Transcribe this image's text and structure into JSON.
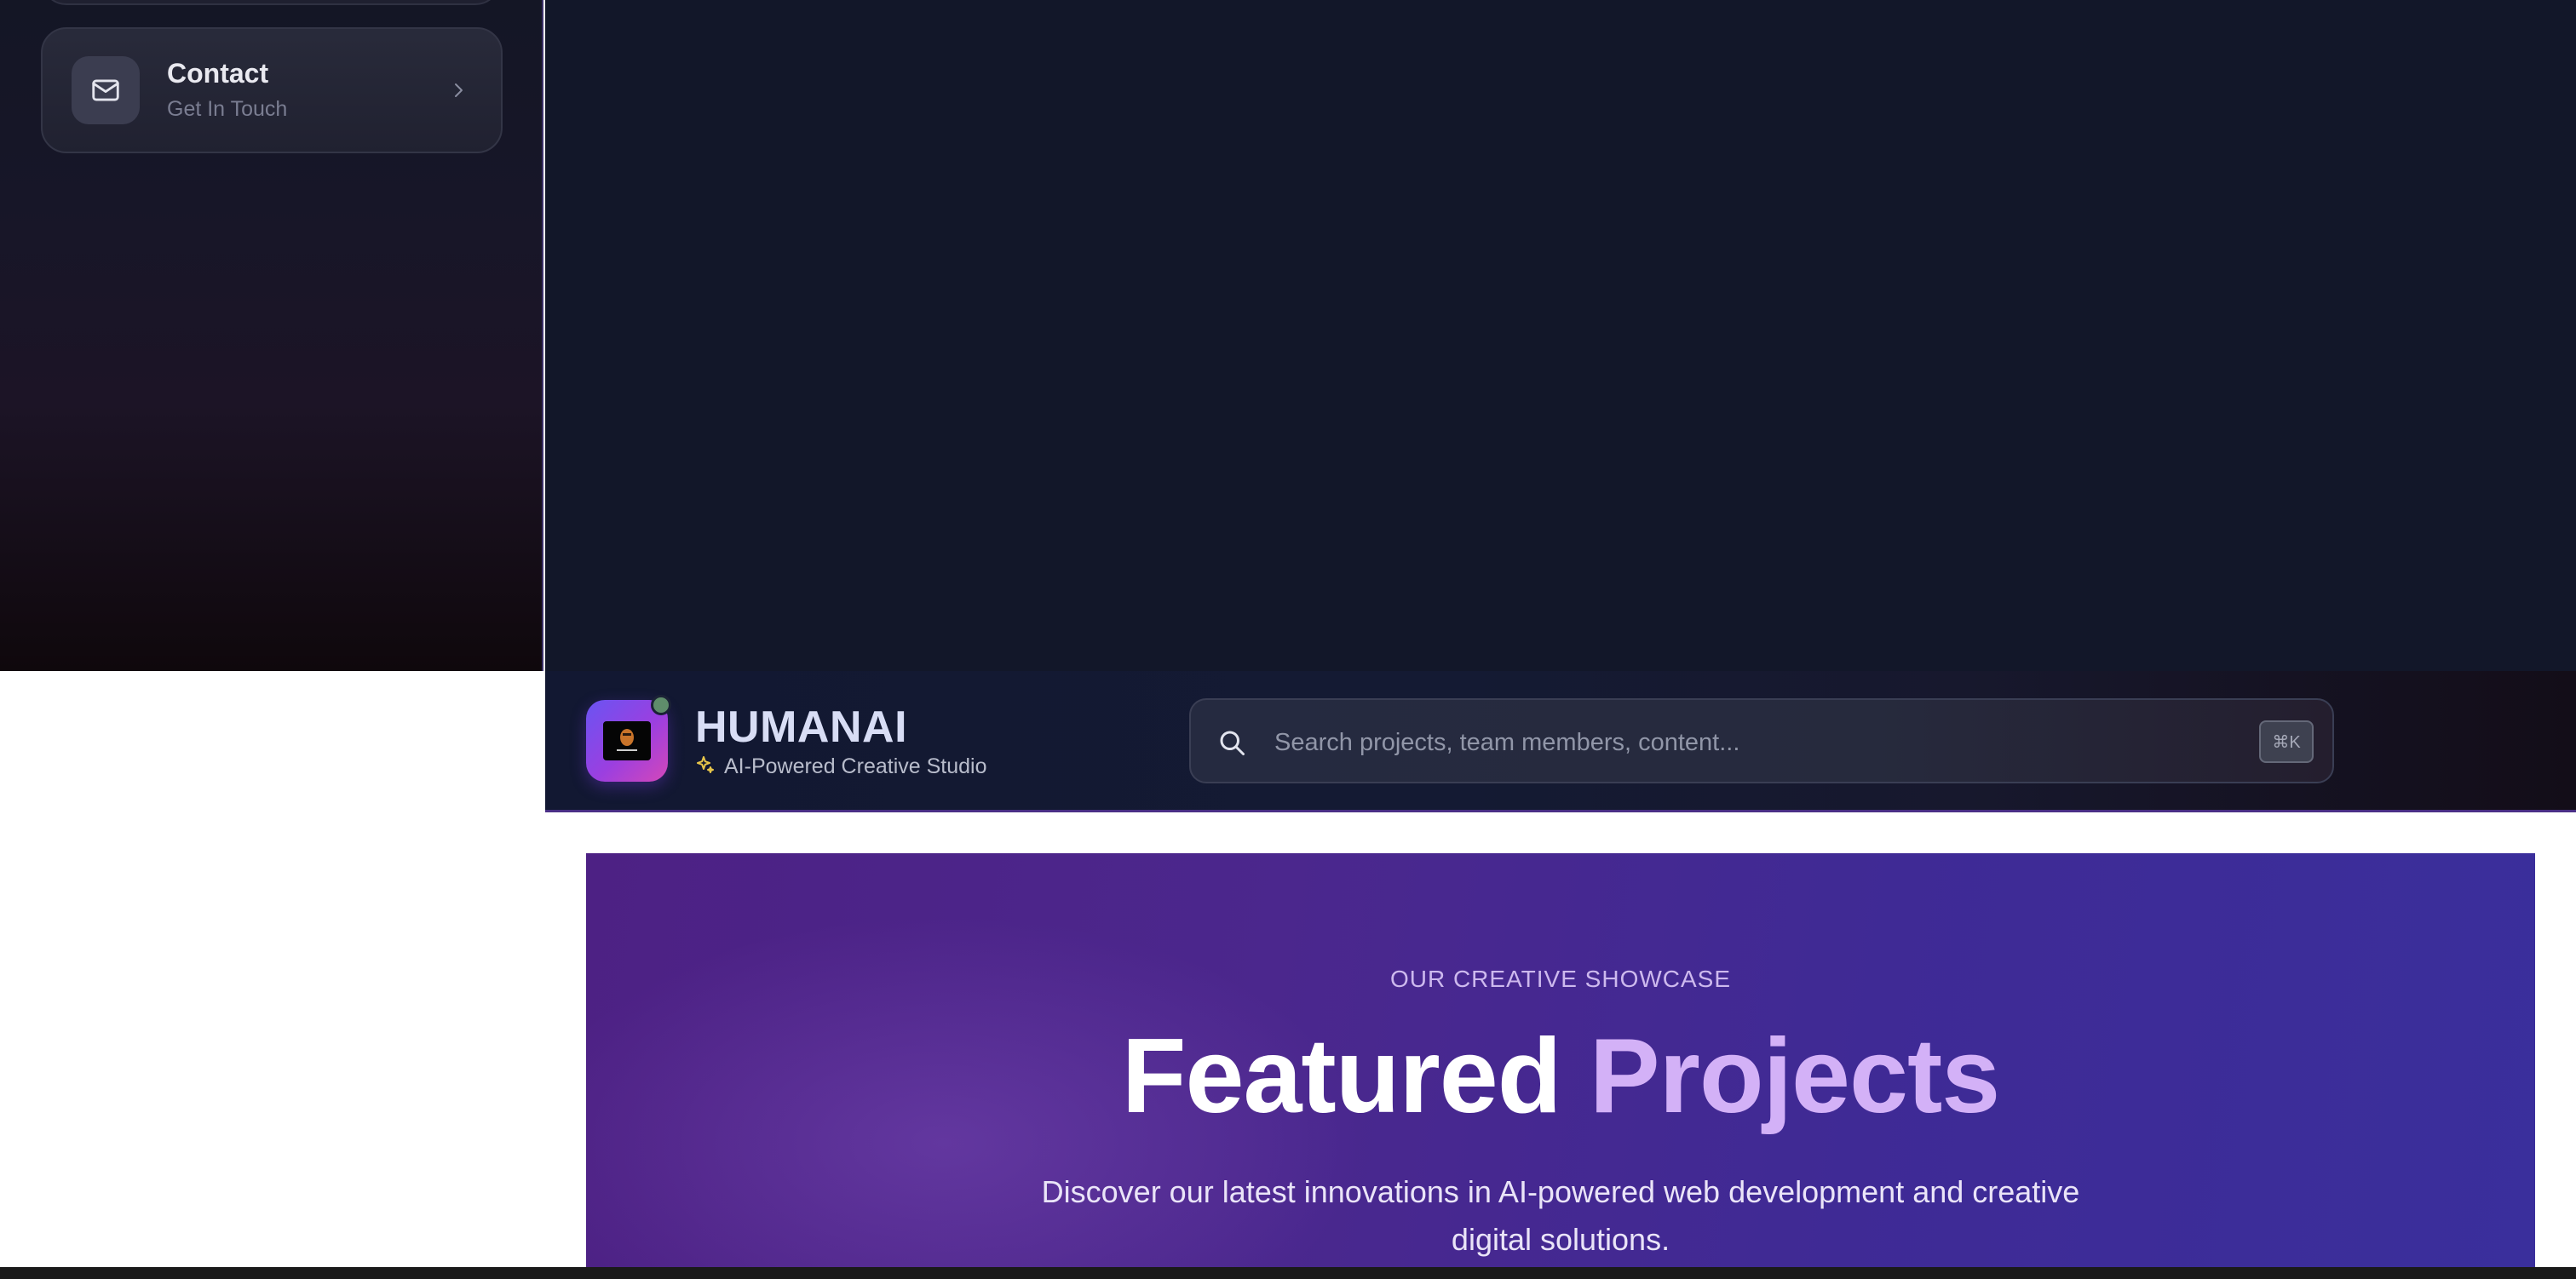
{
  "sidebar": {
    "item": {
      "title": "Contact",
      "subtitle": "Get In Touch",
      "icon": "mail-icon"
    }
  },
  "header": {
    "brand_name": "HUMANAI",
    "tagline": "AI-Powered Creative Studio",
    "logo_inner_label": "HUMANAI",
    "status_color": "#5f8d6b"
  },
  "search": {
    "placeholder": "Search projects, team members, content...",
    "value": "",
    "shortcut": "⌘K"
  },
  "hero": {
    "eyebrow": "OUR CREATIVE SHOWCASE",
    "title_part1": "Featured",
    "title_part2": "Projects",
    "description_line1": "Discover our latest innovations in AI-powered web development and creative",
    "description_line2": "digital solutions."
  },
  "colors": {
    "accent_purple": "#d3b1f7",
    "hero_bg_start": "#4d2184",
    "hero_bg_end": "#3a2f9c",
    "dark_bg": "#121729"
  }
}
